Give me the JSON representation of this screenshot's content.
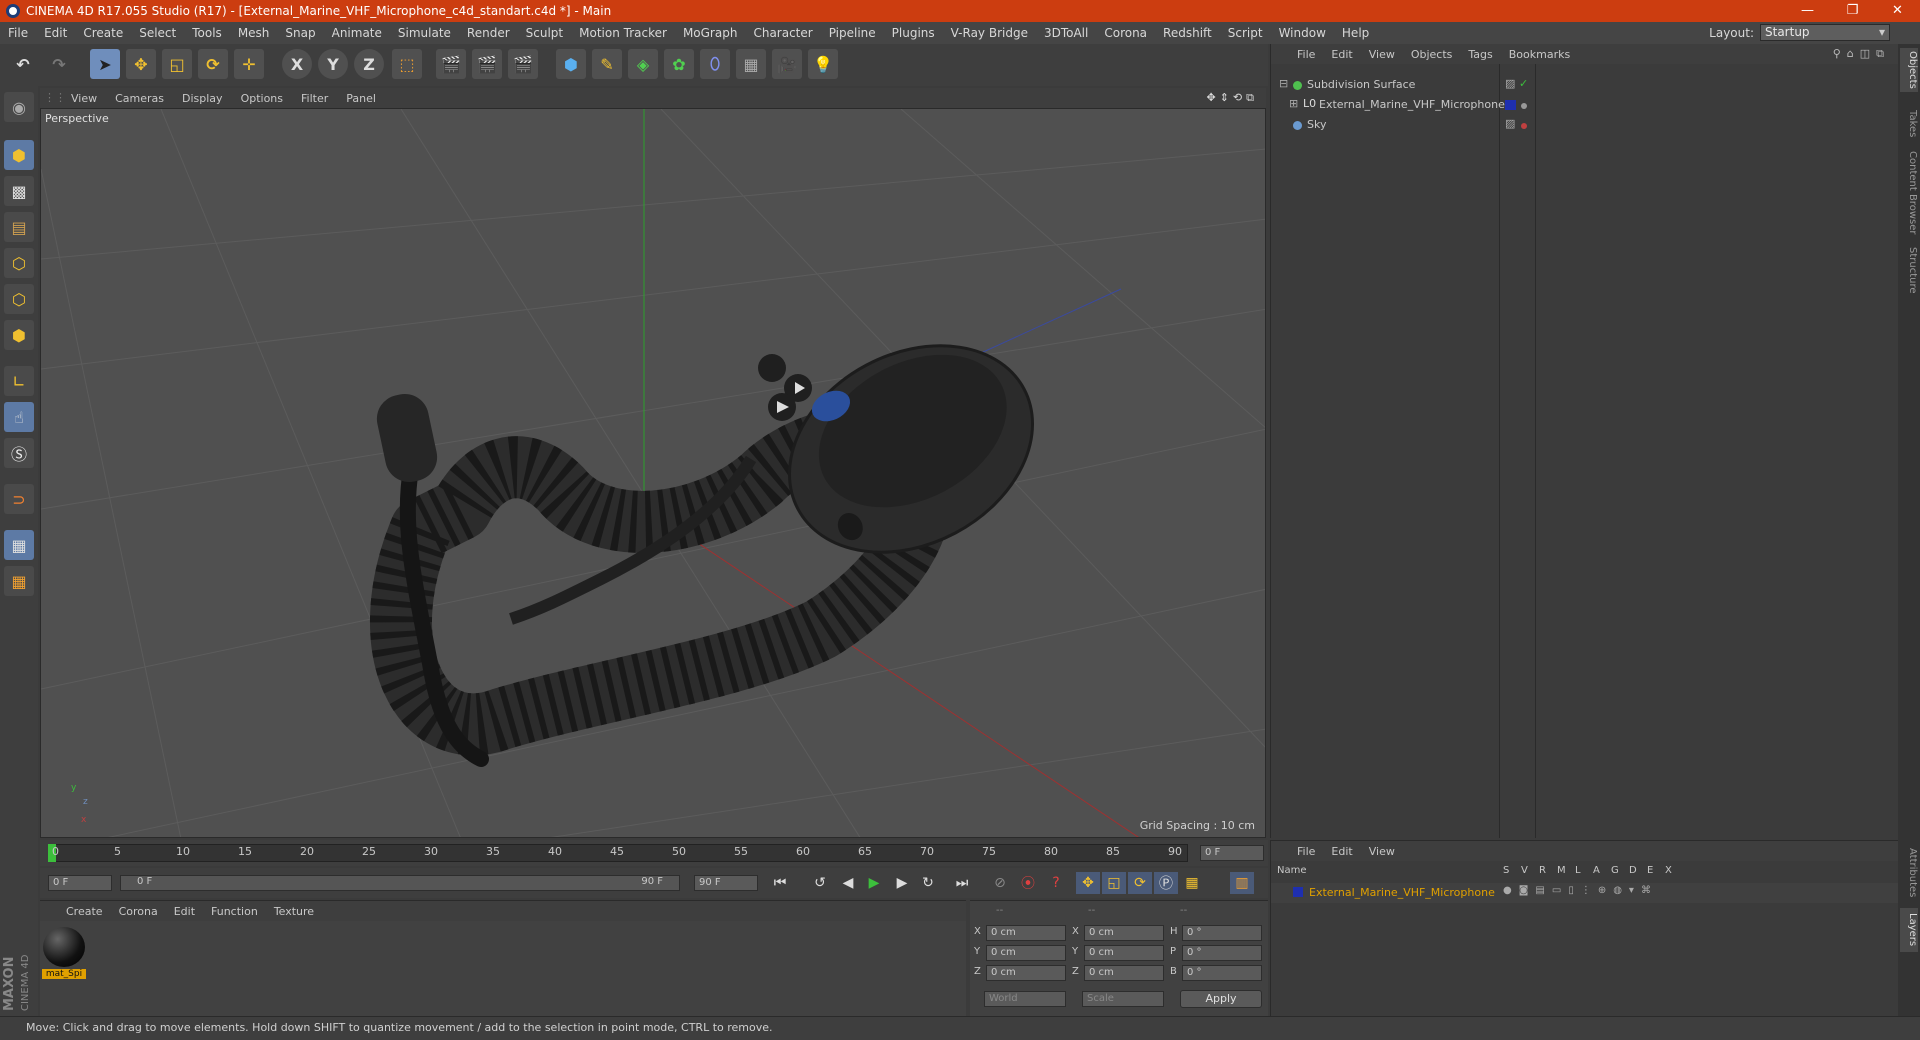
{
  "window": {
    "title": "CINEMA 4D R17.055 Studio (R17) - [External_Marine_VHF_Microphone_c4d_standart.c4d *] - Main",
    "controls": [
      "—",
      "❐",
      "✕"
    ]
  },
  "menubar": {
    "items": [
      "File",
      "Edit",
      "Create",
      "Select",
      "Tools",
      "Mesh",
      "Snap",
      "Animate",
      "Simulate",
      "Render",
      "Sculpt",
      "Motion Tracker",
      "MoGraph",
      "Character",
      "Pipeline",
      "Plugins",
      "V-Ray Bridge",
      "3DToAll",
      "Corona",
      "Redshift",
      "Script",
      "Window",
      "Help"
    ],
    "layout_label": "Layout:",
    "layout_value": "Startup"
  },
  "toolbar": {
    "axis_x": "X",
    "axis_y": "Y",
    "axis_z": "Z"
  },
  "viewport": {
    "menu": [
      "View",
      "Cameras",
      "Display",
      "Options",
      "Filter",
      "Panel"
    ],
    "label": "Perspective",
    "grid_spacing": "Grid Spacing : 10 cm",
    "axis_labels": {
      "y": "y",
      "z": "z",
      "x": "x"
    }
  },
  "timeline": {
    "ticks": [
      "0",
      "5",
      "10",
      "15",
      "20",
      "25",
      "30",
      "35",
      "40",
      "45",
      "50",
      "55",
      "60",
      "65",
      "70",
      "75",
      "80",
      "85",
      "90"
    ],
    "current_frame": "0 F",
    "start_field": "0 F",
    "range_start": "0 F",
    "range_end": "90 F",
    "end_field": "90 F"
  },
  "material_manager": {
    "menu": [
      "Create",
      "Corona",
      "Edit",
      "Function",
      "Texture"
    ],
    "materials": [
      {
        "name": "mat_Spi"
      }
    ]
  },
  "coord_manager": {
    "headers": [
      "--",
      "--",
      "--"
    ],
    "rows": [
      {
        "a": "X",
        "av": "0 cm",
        "b": "X",
        "bv": "0 cm",
        "c": "H",
        "cv": "0 °"
      },
      {
        "a": "Y",
        "av": "0 cm",
        "b": "Y",
        "bv": "0 cm",
        "c": "P",
        "cv": "0 °"
      },
      {
        "a": "Z",
        "av": "0 cm",
        "b": "Z",
        "bv": "0 cm",
        "c": "B",
        "cv": "0 °"
      }
    ],
    "mode": "World",
    "scale": "Scale",
    "apply": "Apply"
  },
  "object_manager": {
    "menu": [
      "File",
      "Edit",
      "View",
      "Objects",
      "Tags",
      "Bookmarks"
    ],
    "objects": [
      {
        "name": "Subdivision Surface",
        "color": "#c8c8c8"
      },
      {
        "name": "External_Marine_VHF_Microphone",
        "color": "#c8c8c8"
      },
      {
        "name": "Sky",
        "color": "#c8c8c8"
      }
    ]
  },
  "layer_manager": {
    "menu": [
      "File",
      "Edit",
      "View"
    ],
    "columns": [
      "Name",
      "S",
      "V",
      "R",
      "M",
      "L",
      "A",
      "G",
      "D",
      "E",
      "X"
    ],
    "layers": [
      {
        "name": "External_Marine_VHF_Microphone",
        "color": "#e0a000"
      }
    ]
  },
  "side_tabs": [
    "Objects",
    "Takes",
    "Content Browser",
    "Structure",
    "Attributes",
    "Layers"
  ],
  "status": "Move: Click and drag to move elements. Hold down SHIFT to quantize movement / add to the selection in point mode, CTRL to remove.",
  "branding": {
    "maxon": "MAXON",
    "product": "CINEMA 4D"
  },
  "colors": {
    "accent": "#cc3d10",
    "selected_tool": "#6f8ebc",
    "layer_name": "#e0a000"
  }
}
